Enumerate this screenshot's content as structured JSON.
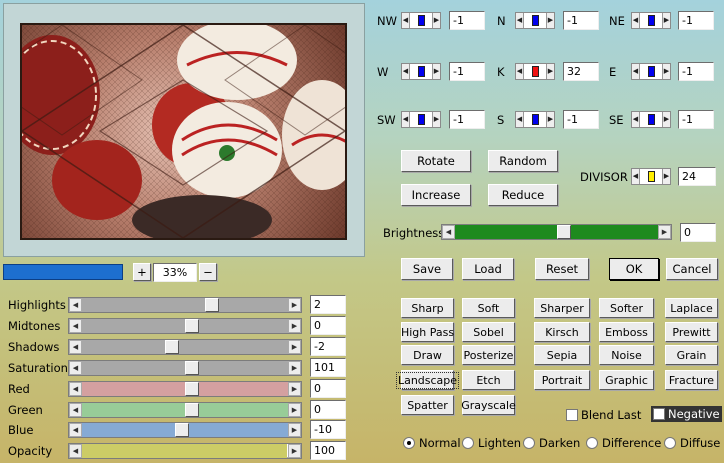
{
  "preview": {
    "zoom": "33%",
    "zoom_in": "+",
    "zoom_out": "−"
  },
  "matrix": [
    {
      "label": "NW",
      "value": "-1",
      "color": "#0000ee"
    },
    {
      "label": "N",
      "value": "-1",
      "color": "#0000ee"
    },
    {
      "label": "NE",
      "value": "-1",
      "color": "#0000ee"
    },
    {
      "label": "W",
      "value": "-1",
      "color": "#0000ee"
    },
    {
      "label": "K",
      "value": "32",
      "color": "#ee1111"
    },
    {
      "label": "E",
      "value": "-1",
      "color": "#0000ee"
    },
    {
      "label": "SW",
      "value": "-1",
      "color": "#0000ee"
    },
    {
      "label": "S",
      "value": "-1",
      "color": "#0000ee"
    },
    {
      "label": "SE",
      "value": "-1",
      "color": "#0000ee"
    }
  ],
  "actions": {
    "rotate": "Rotate",
    "random": "Random",
    "increase": "Increase",
    "reduce": "Reduce"
  },
  "divisor": {
    "label": "DIVISOR",
    "value": "24",
    "color": "#ffee00"
  },
  "brightness": {
    "label": "Brightness",
    "value": "0",
    "level": 0.5
  },
  "dialog": {
    "save": "Save",
    "load": "Load",
    "reset": "Reset",
    "ok": "OK",
    "cancel": "Cancel"
  },
  "adjust": [
    {
      "label": "Highlights",
      "value": "2",
      "color": "#a8a8a8",
      "level": 0.6
    },
    {
      "label": "Midtones",
      "value": "0",
      "color": "#a8a8a8",
      "level": 0.5
    },
    {
      "label": "Shadows",
      "value": "-2",
      "color": "#a8a8a8",
      "level": 0.4
    },
    {
      "label": "Saturation",
      "value": "101",
      "color": "#a8a8a8",
      "level": 0.5
    },
    {
      "label": "Red",
      "value": "0",
      "color": "#d4a0a0",
      "level": 0.5
    },
    {
      "label": "Green",
      "value": "0",
      "color": "#98cc98",
      "level": 0.5
    },
    {
      "label": "Blue",
      "value": "-10",
      "color": "#86aad4",
      "level": 0.45
    },
    {
      "label": "Opacity",
      "value": "100",
      "color": "#cccc66",
      "level": 1.0
    }
  ],
  "filters": [
    [
      "Sharp",
      "Soft",
      "Sharper",
      "Softer",
      "Laplace"
    ],
    [
      "High Pass",
      "Sobel",
      "Kirsch",
      "Emboss",
      "Prewitt"
    ],
    [
      "Draw",
      "Posterize",
      "Sepia",
      "Noise",
      "Grain"
    ],
    [
      "Landscape",
      "Etch",
      "Portrait",
      "Graphic",
      "Fracture"
    ],
    [
      "Spatter",
      "Grayscale"
    ]
  ],
  "options": {
    "blend_last": "Blend Last",
    "negative": "Negative"
  },
  "modes": [
    "Normal",
    "Lighten",
    "Darken",
    "Difference",
    "Diffuse"
  ],
  "selected_mode": "Normal",
  "focused_filter": "Landscape"
}
